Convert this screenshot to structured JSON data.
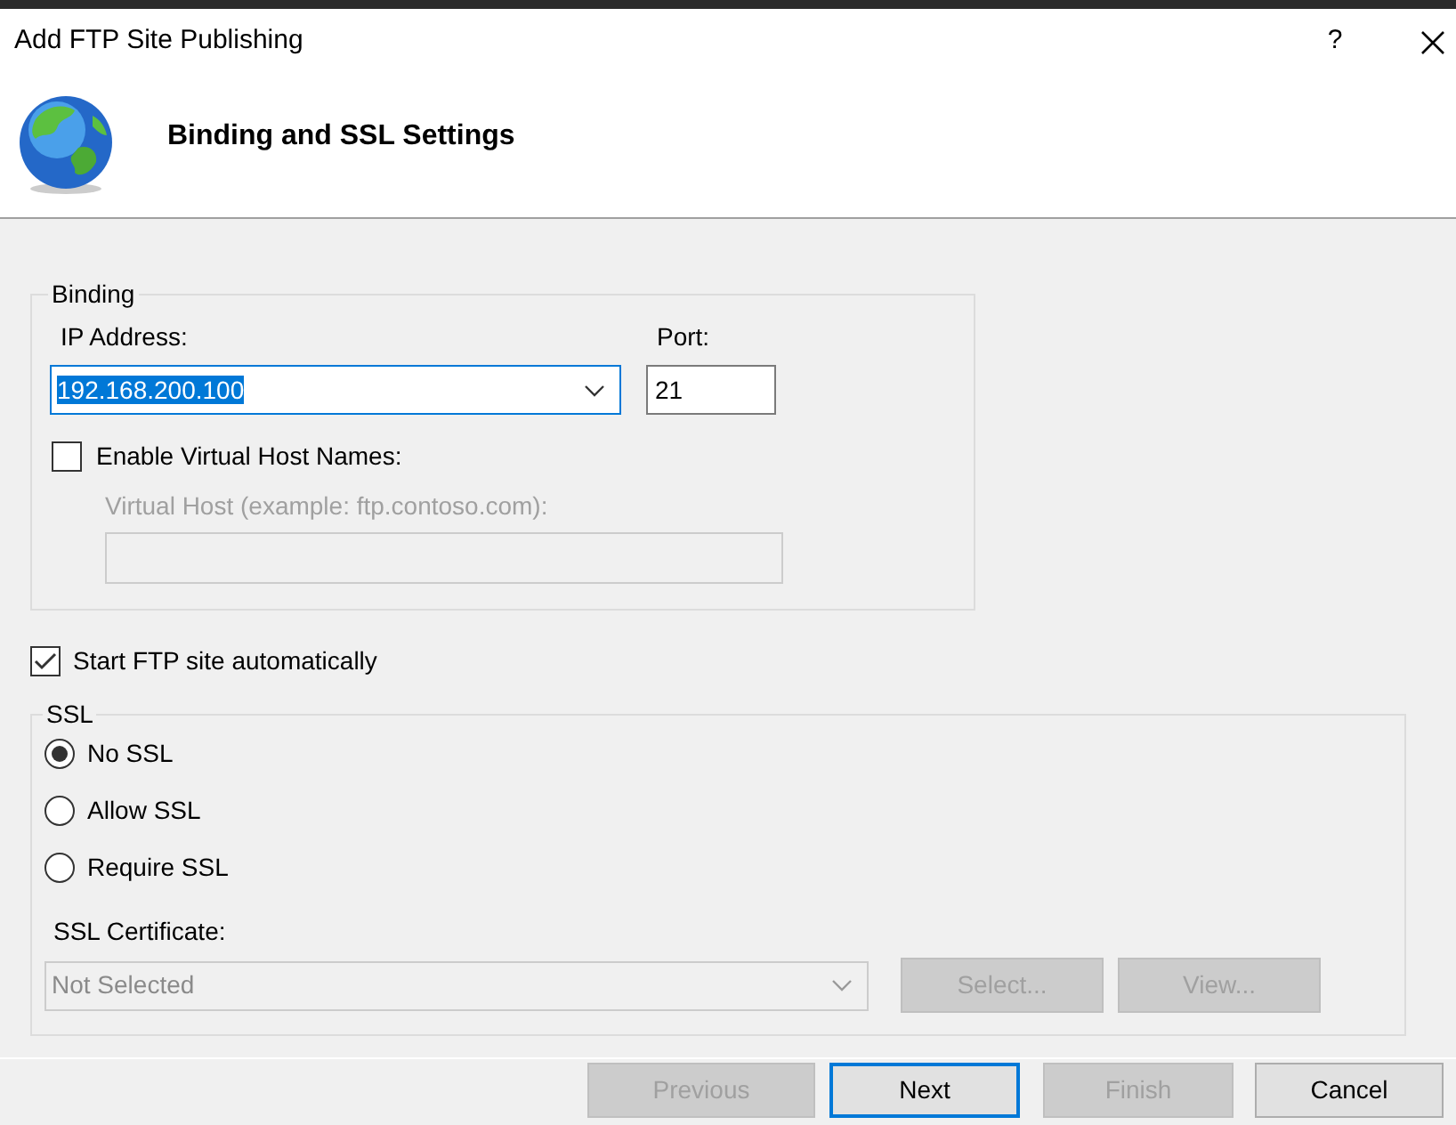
{
  "window": {
    "title": "Add FTP Site Publishing",
    "help": "?"
  },
  "header": {
    "title": "Binding and SSL Settings"
  },
  "binding": {
    "legend": "Binding",
    "ip_label": "IP Address:",
    "ip_value": "192.168.200.100",
    "ip_text_selected": true,
    "port_label": "Port:",
    "port_value": "21",
    "virtual_host_names": {
      "label": "Enable Virtual Host Names:",
      "checked": false
    },
    "virtual_host": {
      "label": "Virtual Host (example: ftp.contoso.com):",
      "disabled": true
    }
  },
  "start_automatically": {
    "label": "Start FTP site automatically",
    "checked": true
  },
  "ssl": {
    "legend": "SSL",
    "options": [
      {
        "label": "No SSL",
        "selected": true
      },
      {
        "label": "Allow SSL",
        "selected": false
      },
      {
        "label": "Require SSL",
        "selected": false
      }
    ],
    "certificate_label": "SSL Certificate:",
    "certificate_value": "Not Selected",
    "certificate_disabled": true,
    "buttons": [
      {
        "label": "Select...",
        "disabled": true
      },
      {
        "label": "View...",
        "disabled": true
      }
    ]
  },
  "footer_buttons": [
    {
      "label": "Previous",
      "disabled": true,
      "focused": false
    },
    {
      "label": "Next",
      "disabled": false,
      "focused": true
    },
    {
      "label": "Finish",
      "disabled": true,
      "focused": false
    },
    {
      "label": "Cancel",
      "disabled": false,
      "focused": false
    }
  ]
}
